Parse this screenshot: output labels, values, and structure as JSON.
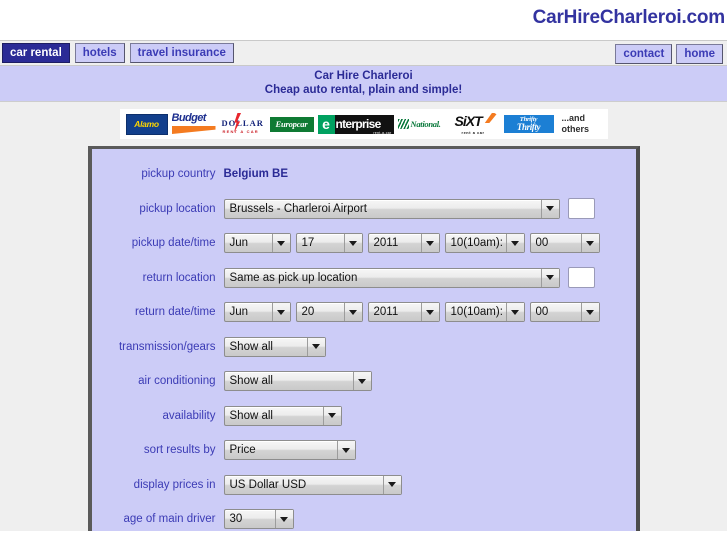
{
  "brand": {
    "site_title": "CarHireCharleroi.com",
    "accent_color": "#3333a0"
  },
  "nav": {
    "left_items": [
      {
        "label": "car rental",
        "active": true
      },
      {
        "label": "hotels",
        "active": false
      },
      {
        "label": "travel insurance",
        "active": false
      }
    ],
    "right_items": [
      {
        "label": "contact"
      },
      {
        "label": "home"
      }
    ]
  },
  "title_band": {
    "line1": "Car Hire Charleroi",
    "line2": "Cheap auto rental, plain and simple!"
  },
  "logos": {
    "items": [
      {
        "name": "alamo",
        "label": "Alamo"
      },
      {
        "name": "budget",
        "label": "Budget"
      },
      {
        "name": "dollar",
        "label": "DOLLAR",
        "sub": "RENT A CAR"
      },
      {
        "name": "europcar",
        "label": "Europcar"
      },
      {
        "name": "enterprise",
        "label": "nterprise",
        "initial": "e",
        "tag": "rent-a-car"
      },
      {
        "name": "national",
        "label": "National."
      },
      {
        "name": "sixt",
        "label": "SiXT",
        "sub": "rent a car"
      },
      {
        "name": "thrifty",
        "label_top": "Thrifty",
        "label_bottom": "Thrifty"
      },
      {
        "name": "others",
        "line1": "...and",
        "line2": "others"
      }
    ]
  },
  "form": {
    "pickup_country": {
      "label": "pickup country",
      "value": "Belgium BE"
    },
    "pickup_location": {
      "label": "pickup location",
      "value": "Brussels - Charleroi Airport",
      "extra_input_value": ""
    },
    "pickup_datetime": {
      "label": "pickup date/time",
      "month": "Jun",
      "day": "17",
      "year": "2011",
      "hour": "10(10am):",
      "minute": "00"
    },
    "return_location": {
      "label": "return location",
      "value": "Same as pick up location",
      "extra_input_value": ""
    },
    "return_datetime": {
      "label": "return date/time",
      "month": "Jun",
      "day": "20",
      "year": "2011",
      "hour": "10(10am):",
      "minute": "00"
    },
    "transmission": {
      "label": "transmission/gears",
      "value": "Show all"
    },
    "air_conditioning": {
      "label": "air conditioning",
      "value": "Show all"
    },
    "availability": {
      "label": "availability",
      "value": "Show all"
    },
    "sort_results_by": {
      "label": "sort results by",
      "value": "Price"
    },
    "display_prices_in": {
      "label": "display prices in",
      "value": "US Dollar USD"
    },
    "age_of_main_driver": {
      "label": "age of main driver",
      "value": "30"
    }
  },
  "colors": {
    "panel_background": "#ccccf7",
    "page_background": "#efefef",
    "label_text": "#3b3bb5",
    "nav_active_background": "#2b2b96"
  }
}
